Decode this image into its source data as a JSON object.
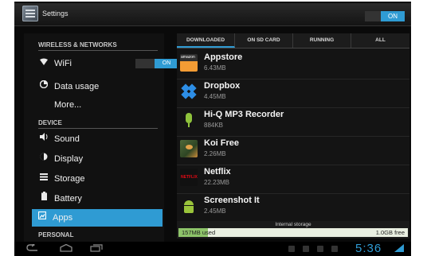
{
  "window": {
    "title": "Settings",
    "master_toggle": "ON"
  },
  "sidebar": {
    "sections": [
      {
        "header": "WIRELESS & NETWORKS"
      },
      {
        "header": "DEVICE"
      },
      {
        "header": "PERSONAL"
      }
    ],
    "items": [
      {
        "label": "WiFi",
        "icon": "wifi-icon",
        "toggle": "ON"
      },
      {
        "label": "Data usage",
        "icon": "data-usage-icon"
      },
      {
        "label": "More..."
      },
      {
        "label": "Sound",
        "icon": "speaker-icon"
      },
      {
        "label": "Display",
        "icon": "display-icon"
      },
      {
        "label": "Storage",
        "icon": "storage-icon"
      },
      {
        "label": "Battery",
        "icon": "battery-icon"
      },
      {
        "label": "Apps",
        "icon": "apps-icon",
        "selected": true
      }
    ]
  },
  "tabs": [
    {
      "label": "DOWNLOADED",
      "active": true
    },
    {
      "label": "ON SD CARD"
    },
    {
      "label": "RUNNING"
    },
    {
      "label": "ALL"
    }
  ],
  "apps": [
    {
      "name": "Appstore",
      "size": "6.43MB",
      "icon": "amazon-appstore-icon"
    },
    {
      "name": "Dropbox",
      "size": "4.45MB",
      "icon": "dropbox-icon"
    },
    {
      "name": "Hi-Q MP3 Recorder",
      "size": "884KB",
      "icon": "microphone-icon"
    },
    {
      "name": "Koi Free",
      "size": "2.26MB",
      "icon": "koi-fish-icon"
    },
    {
      "name": "Netflix",
      "size": "22.23MB",
      "icon": "netflix-icon"
    },
    {
      "name": "Screenshot It",
      "size": "2.45MB",
      "icon": "android-icon"
    }
  ],
  "storage": {
    "label": "Internal storage",
    "used": "157MB used",
    "free": "1.0GB free",
    "used_fraction": 0.13
  },
  "system_bar": {
    "clock": "5:36",
    "accent": "#2f9bd3"
  }
}
